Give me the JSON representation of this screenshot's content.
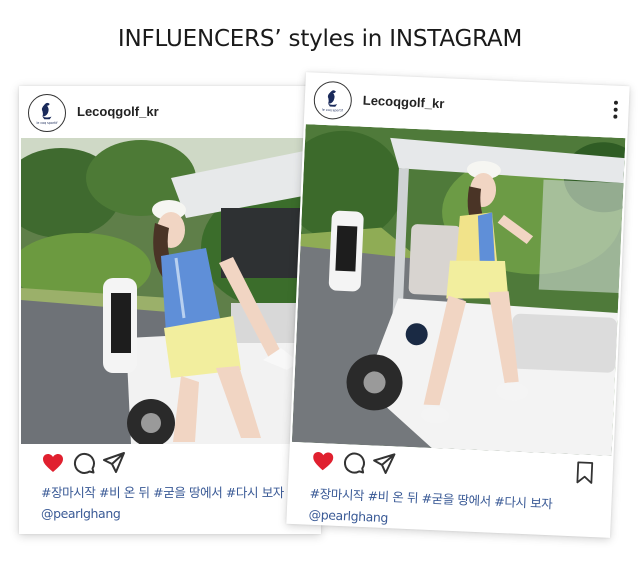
{
  "headline": "INFLUENCERS’ styles in INSTAGRAM",
  "posts": [
    {
      "account": "Lecoqgolf_kr",
      "avatar_text": "le coq sportif",
      "hashtags": "#장마시작 #비 온 뒤 #굳을 땅에서 #다시 보자",
      "mention": "@pearlghang",
      "liked": true,
      "icons": [
        "more-vert-icon",
        "heart-icon",
        "comment-icon",
        "send-icon"
      ]
    },
    {
      "account": "Lecoqgolf_kr",
      "avatar_text": "le coq sportif",
      "hashtags": "#장마시작 #비 온 뒤 #굳을 땅에서 #다시 보자",
      "mention": "@pearlghang",
      "liked": true,
      "icons": [
        "more-vert-icon",
        "heart-icon",
        "comment-icon",
        "send-icon",
        "bookmark-icon"
      ]
    }
  ],
  "colors": {
    "like": "#e0202f",
    "caption": "#3a5a96",
    "icon_stroke": "#333333"
  }
}
